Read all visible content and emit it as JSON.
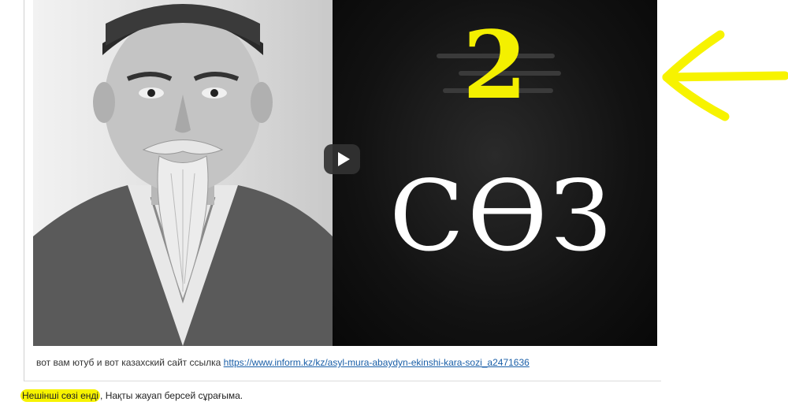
{
  "video": {
    "episode_number": "2",
    "episode_word": "СӨЗ",
    "play_icon": "play-icon",
    "colors": {
      "number_yellow": "#f4f000",
      "title_bg": "#121212",
      "word_white": "#ffffff"
    }
  },
  "caption": {
    "text": "вот вам ютуб и вот казахский сайт ссылка",
    "link_text": "https://www.inform.kz/kz/asyl-mura-abaydyn-ekinshi-kara-sozi_a2471636"
  },
  "reply": {
    "highlighted": "Нешінші сөзі енді",
    "rest": ", Нақты жауап берсей сұрағыма."
  },
  "annotation": {
    "icon": "arrow-left-icon",
    "color": "#f7f300"
  }
}
